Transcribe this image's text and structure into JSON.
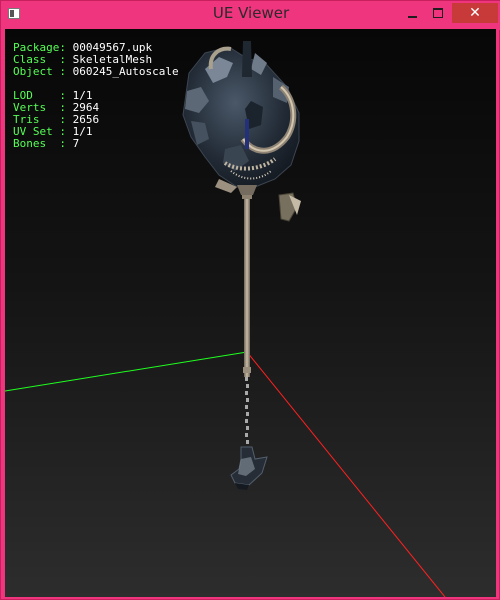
{
  "window": {
    "title": "UE Viewer",
    "close_glyph": "✕"
  },
  "icons": {
    "app": "window-app-icon",
    "minimize": "minimize-icon",
    "maximize": "maximize-icon",
    "close": "close-icon"
  },
  "colors": {
    "titlebar": "#f0357f",
    "close_button": "#c83a3a",
    "info_key": "#55ff55",
    "info_value": "#ffffff",
    "axis_x": "#ff2020",
    "axis_y": "#20ff20",
    "axis_z": "#2020ff"
  },
  "info": {
    "package": {
      "key": "Package:",
      "value": "00049567.upk"
    },
    "class": {
      "key": "Class  :",
      "value": "SkeletalMesh"
    },
    "object": {
      "key": "Object :",
      "value": "060245_Autoscale"
    },
    "lod": {
      "key": "LOD    :",
      "value": "1/1"
    },
    "verts": {
      "key": "Verts  :",
      "value": "2964"
    },
    "tris": {
      "key": "Tris   :",
      "value": "2656"
    },
    "uvset": {
      "key": "UV Set :",
      "value": "1/1"
    },
    "bones": {
      "key": "Bones  :",
      "value": "7"
    }
  }
}
